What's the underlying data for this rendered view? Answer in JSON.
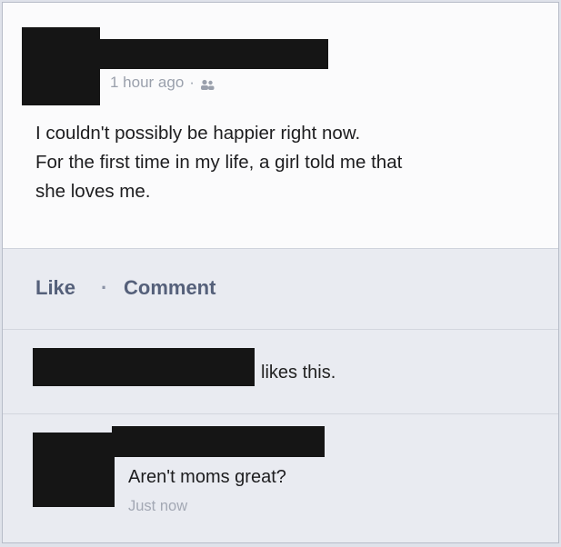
{
  "post": {
    "timestamp": "1 hour ago",
    "meta_separator": "·",
    "audience_icon": "friends-icon",
    "text_lines": [
      "I couldn't possibly be happier right now.",
      "For the first time in my life, a girl told me that",
      "she loves me."
    ]
  },
  "actions": {
    "like_label": "Like",
    "separator": "·",
    "comment_label": "Comment"
  },
  "likes": {
    "text": "likes this."
  },
  "comment": {
    "text": "Aren't moms great?",
    "timestamp": "Just now"
  },
  "colors": {
    "redaction": "#151515",
    "link": "#55607a",
    "muted": "#9aa0ac"
  }
}
